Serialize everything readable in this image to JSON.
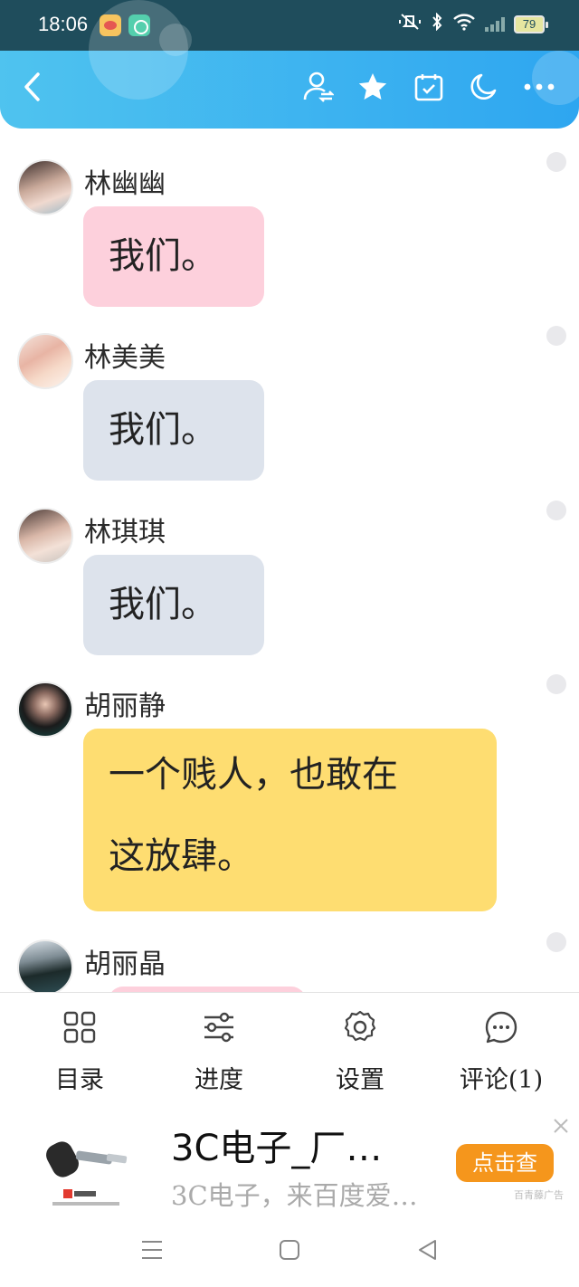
{
  "status_bar": {
    "time": "18:06",
    "battery": "79",
    "icons": [
      "weibo-icon",
      "chat-app-icon",
      "mute-icon",
      "bluetooth-icon",
      "wifi-icon",
      "signal-icon",
      "battery-icon"
    ]
  },
  "top_nav": {
    "icons": [
      "back-icon",
      "user-switch-icon",
      "star-icon",
      "calendar-check-icon",
      "moon-icon",
      "more-icon"
    ],
    "accent": "#2ea6f0"
  },
  "messages": [
    {
      "sender": "林幽幽",
      "text": "我们。",
      "bubble_color": "#fdd0dc"
    },
    {
      "sender": "林美美",
      "text": "我们。",
      "bubble_color": "#dde3ec"
    },
    {
      "sender": "林琪琪",
      "text": "我们。",
      "bubble_color": "#dde3ec"
    },
    {
      "sender": "胡丽静",
      "text_line1": "一个贱人，也敢在",
      "text_line2": "这放肆。",
      "bubble_color": "#fedd71"
    },
    {
      "sender": "胡丽晶",
      "bubble_color": "#fdd0dc"
    }
  ],
  "bottom_tabs": [
    {
      "label": "目录",
      "icon": "grid-icon"
    },
    {
      "label": "进度",
      "icon": "sliders-icon"
    },
    {
      "label": "设置",
      "icon": "gear-icon"
    },
    {
      "label": "评论(1)",
      "icon": "comment-icon"
    }
  ],
  "ad": {
    "title": "3C电子_厂…",
    "subtitle": "3C电子，来百度爱…",
    "button": "点击查",
    "tag": "百青藤广告",
    "button_color": "#f5961c"
  },
  "system_nav": {
    "icons": [
      "menu-icon",
      "home-icon",
      "back-triangle-icon"
    ]
  }
}
